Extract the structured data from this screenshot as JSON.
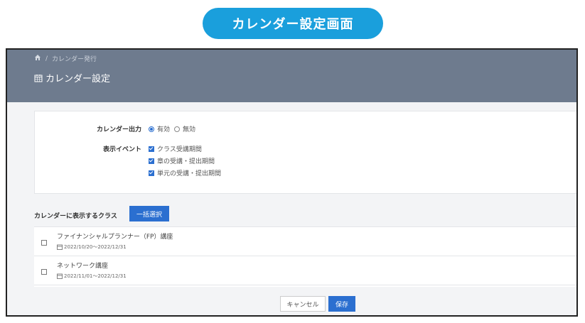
{
  "banner": {
    "title": "カレンダー設定画面"
  },
  "breadcrumb": {
    "home_icon": "home-icon",
    "separator": "/",
    "item": "カレンダー発行"
  },
  "page": {
    "title": "カレンダー設定",
    "icon": "calendar-icon"
  },
  "form": {
    "output": {
      "label": "カレンダー出力",
      "options": [
        {
          "label": "有効",
          "selected": true
        },
        {
          "label": "無効",
          "selected": false
        }
      ]
    },
    "events": {
      "label": "表示イベント",
      "options": [
        {
          "label": "クラス受講期間",
          "checked": true
        },
        {
          "label": "章の受講・提出期間",
          "checked": true
        },
        {
          "label": "単元の受講・提出期間",
          "checked": true
        }
      ]
    }
  },
  "classes": {
    "section_label": "カレンダーに表示するクラス",
    "select_all_button": "一括選択",
    "items": [
      {
        "name": "ファイナンシャルプランナー（FP）講座",
        "period": "2022/10/20〜2022/12/31",
        "checked": false
      },
      {
        "name": "ネットワーク講座",
        "period": "2022/11/01〜2022/12/31",
        "checked": false
      }
    ]
  },
  "actions": {
    "cancel": "キャンセル",
    "save": "保存"
  },
  "colors": {
    "accent": "#2b6fd0",
    "banner": "#1a9fdc",
    "header": "#6e7b8e"
  }
}
